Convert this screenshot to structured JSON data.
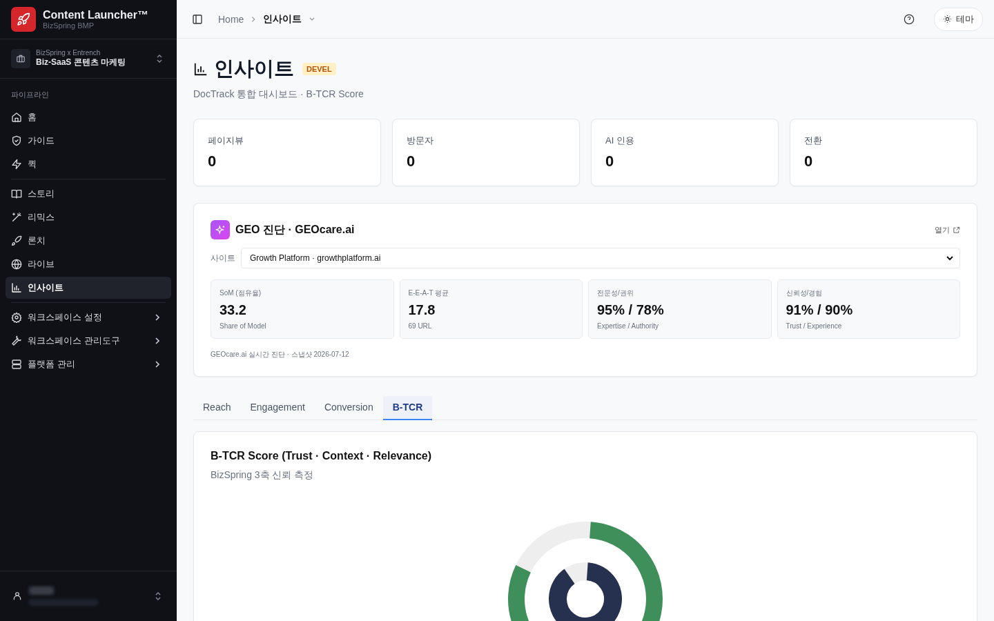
{
  "brand": {
    "title": "Content Launcher™",
    "subtitle": "BizSpring BMP"
  },
  "workspace": {
    "org": "BizSpring x Entrench",
    "name": "Biz-SaaS 콘텐츠 마케팅"
  },
  "sidebar": {
    "section_label": "파이프라인",
    "groups": [
      [
        {
          "label": "홈",
          "selected": false,
          "expandable": false
        },
        {
          "label": "가이드",
          "selected": false,
          "expandable": false
        },
        {
          "label": "퀵",
          "selected": false,
          "expandable": false
        }
      ],
      [
        {
          "label": "스토리",
          "selected": false,
          "expandable": false
        },
        {
          "label": "리믹스",
          "selected": false,
          "expandable": false
        },
        {
          "label": "론치",
          "selected": false,
          "expandable": false
        },
        {
          "label": "라이브",
          "selected": false,
          "expandable": false
        },
        {
          "label": "인사이트",
          "selected": true,
          "expandable": false
        }
      ],
      [
        {
          "label": "워크스페이스 설정",
          "selected": false,
          "expandable": true
        },
        {
          "label": "워크스페이스 관리도구",
          "selected": false,
          "expandable": true
        },
        {
          "label": "플랫폼 관리",
          "selected": false,
          "expandable": true
        }
      ]
    ]
  },
  "breadcrumb": [
    "Home",
    "인사이트"
  ],
  "theme_button": "테마",
  "page": {
    "title": "인사이트",
    "badge": "DEVEL",
    "subtitle": "DocTrack 통합 대시보드 · B-TCR Score"
  },
  "stats": [
    {
      "label": "페이지뷰",
      "value": "0"
    },
    {
      "label": "방문자",
      "value": "0"
    },
    {
      "label": "AI 인용",
      "value": "0"
    },
    {
      "label": "전환",
      "value": "0"
    }
  ],
  "geo": {
    "title": "GEO 진단 · GEOcare.ai",
    "open_link": "열기",
    "site_label": "사이트",
    "site_value": "Growth Platform · growthplatform.ai",
    "metrics": [
      {
        "label": "SoM (점유율)",
        "value": "33.2",
        "note": "Share of Model"
      },
      {
        "label": "E-E-A-T 평균",
        "value": "17.8",
        "note": "69 URL"
      },
      {
        "label": "전문성/권위",
        "value": "95% / 78%",
        "note": "Expertise / Authority"
      },
      {
        "label": "신뢰성/경험",
        "value": "91% / 90%",
        "note": "Trust / Experience"
      }
    ],
    "footnote": "GEOcare.ai 실시간 진단 · 스냅샷 2026-07-12"
  },
  "tabs": [
    {
      "label": "Reach",
      "selected": false
    },
    {
      "label": "Engagement",
      "selected": false
    },
    {
      "label": "Conversion",
      "selected": false
    },
    {
      "label": "B-TCR",
      "selected": true
    }
  ],
  "score_card": {
    "title": "B-TCR Score (Trust · Context · Relevance)",
    "subtitle": "BizSpring 3축 신뢰 측정"
  }
}
